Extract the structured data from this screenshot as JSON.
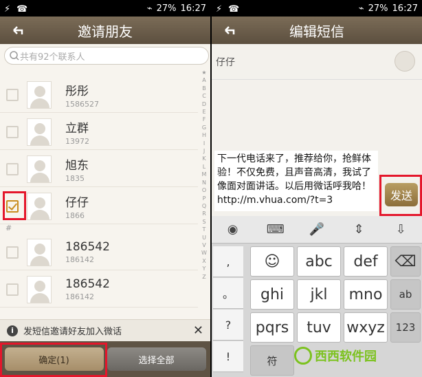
{
  "status": {
    "battery": "27%",
    "time": "16:27"
  },
  "left": {
    "title": "邀请朋友",
    "search_placeholder": "共有92个联系人",
    "contacts": [
      {
        "name": "彤彤",
        "number": "1586527",
        "checked": false
      },
      {
        "name": "立群",
        "number": "13972",
        "checked": false
      },
      {
        "name": "旭东",
        "number": "1835",
        "checked": false
      },
      {
        "name": "仔仔",
        "number": "1866",
        "checked": true
      },
      {
        "name": "186542",
        "number": "186142",
        "checked": false
      },
      {
        "name": "186542",
        "number": "186142",
        "checked": false
      }
    ],
    "section_label": "#",
    "alphabet": [
      "★",
      "A",
      "B",
      "C",
      "D",
      "E",
      "F",
      "G",
      "H",
      "I",
      "J",
      "K",
      "L",
      "M",
      "N",
      "O",
      "P",
      "Q",
      "R",
      "S",
      "T",
      "U",
      "V",
      "W",
      "X",
      "Y",
      "Z"
    ],
    "info_text": "发短信邀请好友加入微话",
    "confirm_label": "确定(1)",
    "select_all_label": "选择全部"
  },
  "right": {
    "title": "编辑短信",
    "recipient": "仔仔",
    "message": "下一代电话来了，推荐给你，抢鲜体验！不仅免费，且声音高清，我试了像面对面讲话。以后用微话呼我哈！http://m.vhua.com/?t=3",
    "send_label": "发送",
    "keyboard": {
      "row1": [
        "☺",
        "abc",
        "def"
      ],
      "row2": [
        "ghi",
        "jkl",
        "mno"
      ],
      "row3": [
        "pqrs",
        "tuv",
        "wxyz"
      ],
      "side": [
        ",",
        "。",
        "?",
        "!",
        "..."
      ],
      "space_label": "符",
      "ab_label": "ab",
      "num_label": "123"
    },
    "watermark": "西西软件园"
  }
}
